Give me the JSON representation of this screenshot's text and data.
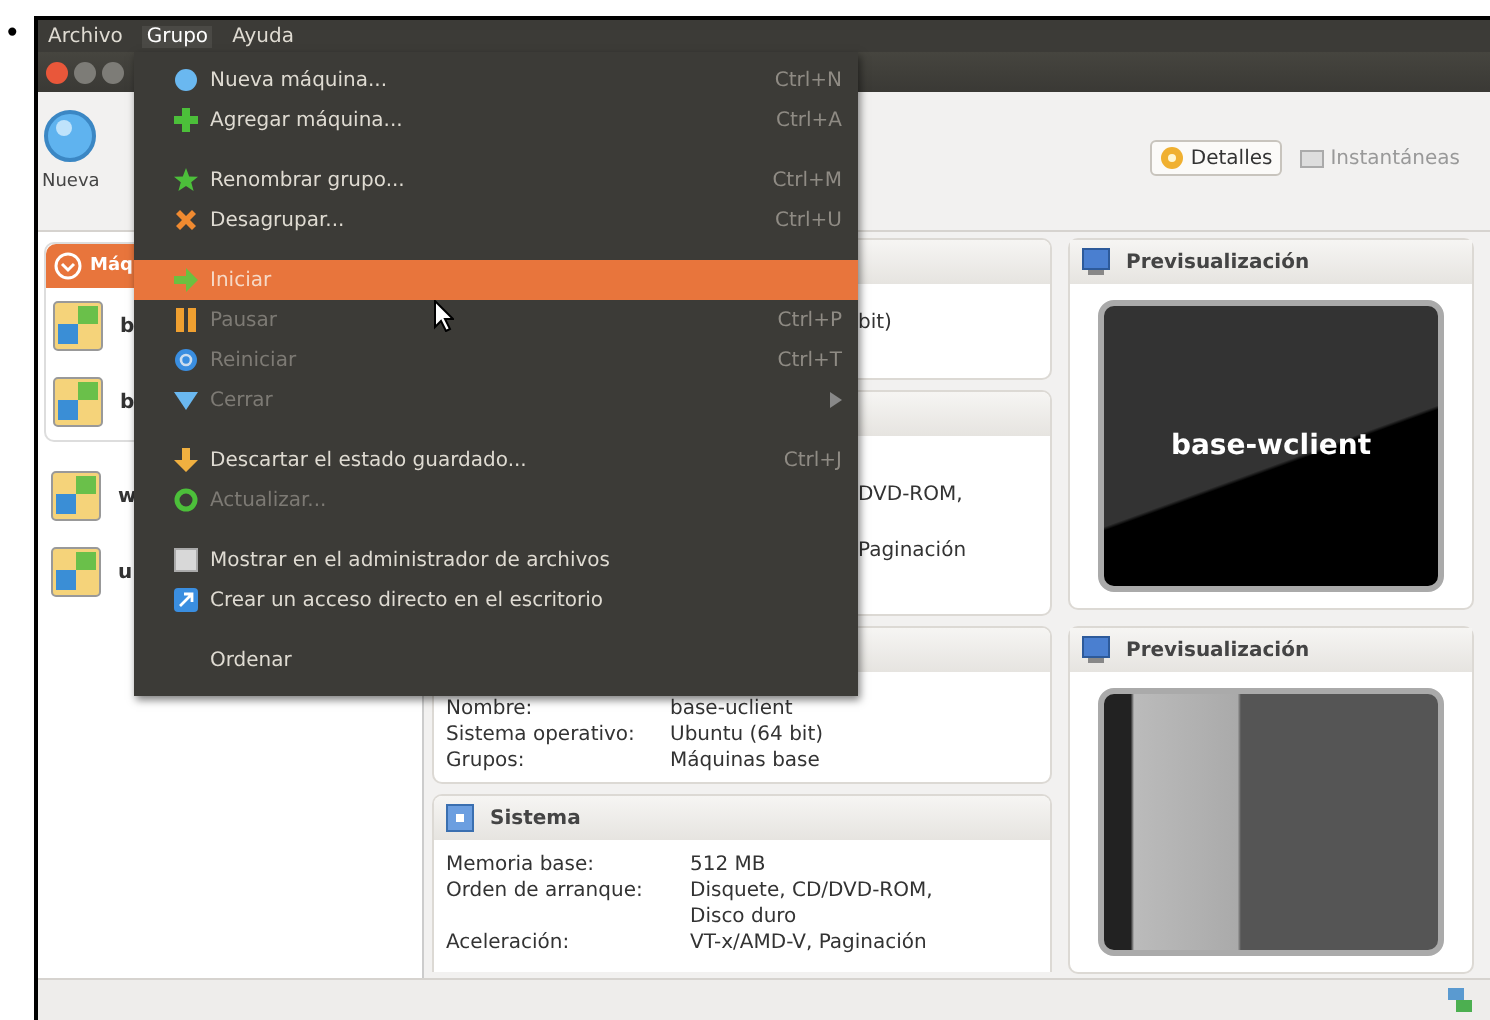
{
  "bullet": "•",
  "menubar": [
    {
      "label": "Archivo",
      "selected": false
    },
    {
      "label": "Grupo",
      "selected": true
    },
    {
      "label": "Ayuda",
      "selected": false
    }
  ],
  "toolbar": {
    "new_button": "Nueva",
    "tabs": [
      {
        "label": "Detalles",
        "selected": true
      },
      {
        "label": "Instantáneas",
        "selected": false
      }
    ]
  },
  "machine_list": {
    "group_header": "Máq",
    "group_items": [
      {
        "name": "b"
      },
      {
        "name": "b"
      }
    ],
    "items": [
      {
        "name": "w"
      },
      {
        "name": "u"
      }
    ]
  },
  "details_top": [
    {
      "value": "bit)"
    },
    {
      "value": "DVD-ROM,"
    },
    {
      "value": "Paginación"
    }
  ],
  "general": [
    {
      "label": "Nombre:",
      "value": "base-uclient"
    },
    {
      "label": "Sistema operativo:",
      "value": "Ubuntu (64 bit)"
    },
    {
      "label": "Grupos:",
      "value": "Máquinas base"
    }
  ],
  "system": {
    "title": "Sistema",
    "rows": [
      {
        "label": "Memoria base:",
        "value": "512 MB"
      },
      {
        "label": "Orden de arranque:",
        "value": "Disquete, CD/DVD-ROM,"
      },
      {
        "label": "",
        "value": "Disco duro"
      },
      {
        "label": "Aceleración:",
        "value": "VT-x/AMD-V, Paginación"
      }
    ]
  },
  "previews": [
    {
      "title": "Previsualización",
      "kind": "text",
      "screen_text": "base-wclient"
    },
    {
      "title": "Previsualización",
      "kind": "desktop"
    }
  ],
  "menu": [
    {
      "kind": "item",
      "label": "Nueva máquina...",
      "shortcut": "Ctrl+N",
      "disabled": false,
      "selected": false,
      "submenu": false
    },
    {
      "kind": "item",
      "label": "Agregar máquina...",
      "shortcut": "Ctrl+A",
      "disabled": false,
      "selected": false,
      "submenu": false
    },
    {
      "kind": "separator"
    },
    {
      "kind": "item",
      "label": "Renombrar grupo...",
      "shortcut": "Ctrl+M",
      "disabled": false,
      "selected": false,
      "submenu": false
    },
    {
      "kind": "item",
      "label": "Desagrupar...",
      "shortcut": "Ctrl+U",
      "disabled": false,
      "selected": false,
      "submenu": false
    },
    {
      "kind": "separator"
    },
    {
      "kind": "item",
      "label": "Iniciar",
      "disabled": false,
      "selected": true,
      "submenu": false
    },
    {
      "kind": "item",
      "label": "Pausar",
      "shortcut": "Ctrl+P",
      "disabled": true,
      "selected": false,
      "submenu": false
    },
    {
      "kind": "item",
      "label": "Reiniciar",
      "shortcut": "Ctrl+T",
      "disabled": true,
      "selected": false,
      "submenu": false
    },
    {
      "kind": "item",
      "label": "Cerrar",
      "disabled": true,
      "selected": false,
      "submenu": true
    },
    {
      "kind": "separator"
    },
    {
      "kind": "item",
      "label": "Descartar el estado guardado...",
      "shortcut": "Ctrl+J",
      "disabled": false,
      "selected": false,
      "submenu": false
    },
    {
      "kind": "item",
      "label": "Actualizar...",
      "disabled": true,
      "selected": false,
      "submenu": false
    },
    {
      "kind": "separator"
    },
    {
      "kind": "item",
      "label": "Mostrar en el administrador de archivos",
      "disabled": false,
      "selected": false,
      "submenu": false
    },
    {
      "kind": "item",
      "label": "Crear un acceso directo en el escritorio",
      "disabled": false,
      "selected": false,
      "submenu": false
    },
    {
      "kind": "separator"
    },
    {
      "kind": "item",
      "label": "Ordenar",
      "disabled": false,
      "selected": false,
      "submenu": false
    }
  ]
}
